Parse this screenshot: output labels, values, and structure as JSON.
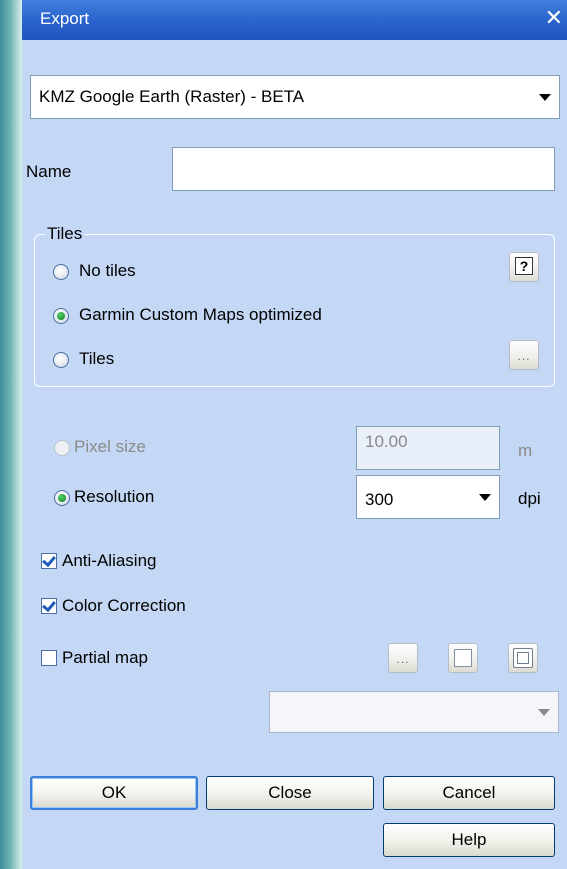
{
  "window": {
    "title": "Export"
  },
  "format": {
    "selected": "KMZ Google Earth (Raster) - BETA"
  },
  "name_field": {
    "label": "Name",
    "value": ""
  },
  "tiles": {
    "legend": "Tiles",
    "options": [
      "No tiles",
      "Garmin Custom Maps optimized",
      "Tiles"
    ],
    "selected_index": 1
  },
  "pixel_size": {
    "label": "Pixel size",
    "value": "10.00",
    "unit": "m"
  },
  "resolution": {
    "label": "Resolution",
    "value": "300",
    "unit": "dpi"
  },
  "anti_aliasing": {
    "label": "Anti-Aliasing",
    "checked": true
  },
  "color_correction": {
    "label": "Color Correction",
    "checked": true
  },
  "partial_map": {
    "label": "Partial map",
    "checked": false,
    "selected": ""
  },
  "small_buttons": {
    "dots": "...",
    "help": "?"
  },
  "buttons": {
    "ok": "OK",
    "close": "Close",
    "cancel": "Cancel",
    "help": "Help"
  }
}
